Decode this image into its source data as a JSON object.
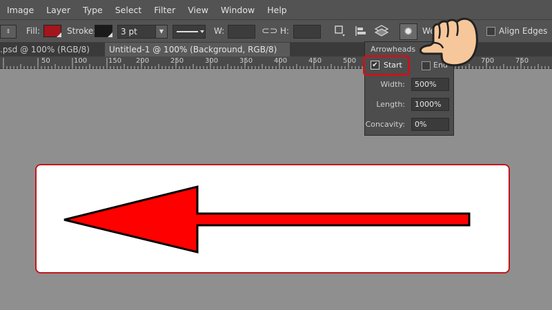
{
  "menu": {
    "items": [
      "Image",
      "Layer",
      "Type",
      "Select",
      "Filter",
      "View",
      "Window",
      "Help"
    ]
  },
  "options": {
    "fill_label": "Fill:",
    "fill_color": "#a3161c",
    "stroke_label": "Stroke:",
    "stroke_color": "#1a1a1a",
    "stroke_width": "3 pt",
    "w_label": "W:",
    "w_value": "",
    "h_label": "H:",
    "h_value": "",
    "weight_label": "We",
    "align_edges_label": "Align Edges"
  },
  "tabs": [
    {
      "label": ".psd @ 100% (RGB/8) *",
      "close": "×",
      "active": false
    },
    {
      "label": "Untitled-1 @ 100% (Background, RGB/8) *",
      "close": "×",
      "active": true
    }
  ],
  "ruler": {
    "ticks": [
      "50",
      "100",
      "150",
      "200",
      "250",
      "300",
      "350",
      "400",
      "450",
      "500",
      "700",
      "750"
    ]
  },
  "arrowheads_popup": {
    "title": "Arrowheads",
    "start_label": "Start",
    "start_checked": true,
    "end_label": "End",
    "end_checked": false,
    "width_label": "Width:",
    "width_value": "500%",
    "length_label": "Length:",
    "length_value": "1000%",
    "concavity_label": "Concavity:",
    "concavity_value": "0%"
  },
  "canvas": {
    "arrow_color": "#ff0000",
    "box_border_color": "#c4161c",
    "highlight_color": "#c4161c"
  }
}
